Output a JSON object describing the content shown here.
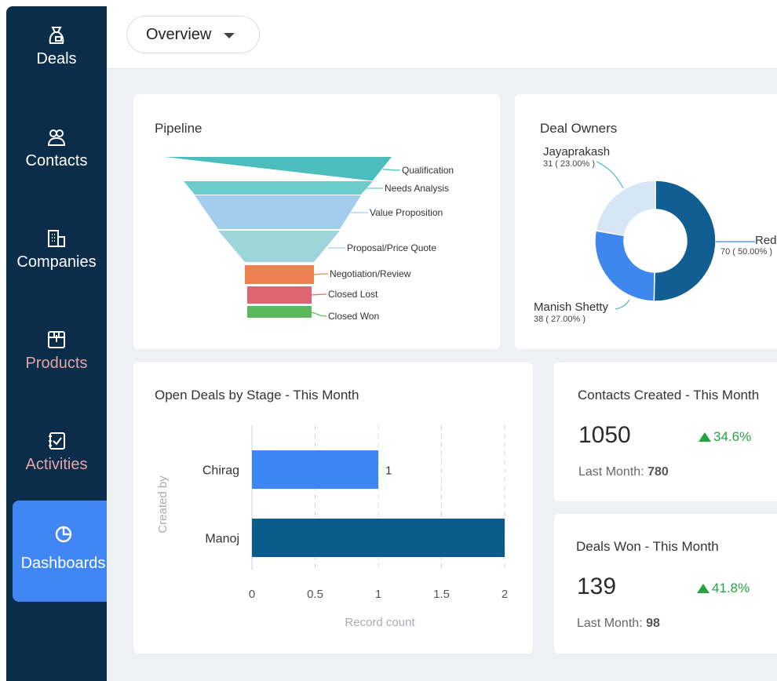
{
  "sidebar": {
    "items": [
      {
        "label": "Deals",
        "icon": "deals-bag-icon"
      },
      {
        "label": "Contacts",
        "icon": "contacts-icon"
      },
      {
        "label": "Companies",
        "icon": "building-icon"
      },
      {
        "label": "Products",
        "icon": "box-icon"
      },
      {
        "label": "Activities",
        "icon": "task-check-icon"
      },
      {
        "label": "Dashboards",
        "icon": "pie-chart-icon",
        "active": true
      }
    ]
  },
  "header": {
    "view_label": "Overview"
  },
  "colors": {
    "sidebar_bg": "#0c2d49",
    "active_bg": "#4186f5",
    "positive": "#27a244"
  },
  "pipeline": {
    "title": "Pipeline"
  },
  "deal_owners": {
    "title": "Deal Owners"
  },
  "open_deals": {
    "title": "Open Deals by Stage - This Month"
  },
  "contacts_created": {
    "title": "Contacts Created - This Month",
    "value": "1050",
    "change": "34.6%",
    "last_label": "Last Month:",
    "last_value": "780"
  },
  "deals_won": {
    "title": "Deals Won - This Month",
    "value": "139",
    "change": "41.8%",
    "last_label": "Last Month:",
    "last_value": "98"
  },
  "chart_data": [
    {
      "type": "funnel",
      "title": "Pipeline",
      "stages": [
        {
          "label": "Qualification",
          "color": "#4bbdbd"
        },
        {
          "label": "Needs Analysis",
          "color": "#6ccccb"
        },
        {
          "label": "Value Proposition",
          "color": "#a3cdec"
        },
        {
          "label": "Proposal/Price Quote",
          "color": "#9dd5da"
        },
        {
          "label": "Negotiation/Review",
          "color": "#ee7f4f"
        },
        {
          "label": "Closed Lost",
          "color": "#de6471"
        },
        {
          "label": "Closed Won",
          "color": "#5cb85c"
        }
      ]
    },
    {
      "type": "pie",
      "title": "Deal Owners",
      "slices": [
        {
          "name": "Red",
          "value": 70,
          "percent": "70 ( 50.00% )",
          "color": "#115f92"
        },
        {
          "name": "Manish Shetty",
          "value": 38,
          "percent": "38 ( 27.00% )",
          "color": "#3d87ef"
        },
        {
          "name": "Jayaprakash",
          "value": 31,
          "percent": "31 ( 23.00% )",
          "color": "#d6e6f4"
        }
      ]
    },
    {
      "type": "bar",
      "orientation": "horizontal",
      "title": "Open Deals by Stage - This Month",
      "categories": [
        "Chirag",
        "Manoj"
      ],
      "values": [
        1,
        2
      ],
      "colors": [
        "#3d87f5",
        "#0b5c8c"
      ],
      "data_labels": [
        "1",
        ""
      ],
      "xlabel": "Record count",
      "ylabel": "Created by",
      "xlim": [
        0,
        2
      ],
      "xticks": [
        "0",
        "0.5",
        "1",
        "1.5",
        "2"
      ],
      "grid": "vertical dashed"
    }
  ]
}
